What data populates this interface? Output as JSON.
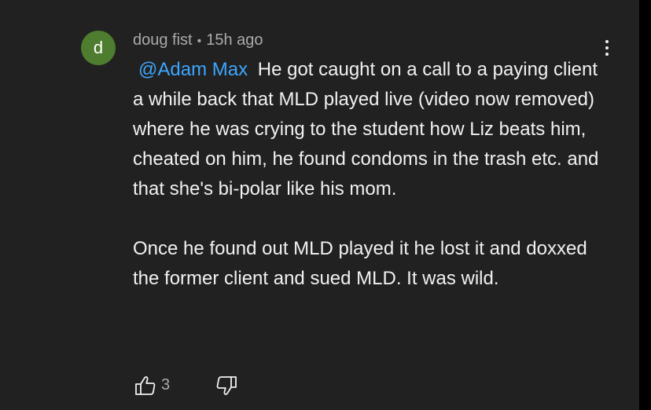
{
  "comment": {
    "avatar_letter": "d",
    "author": "doug fist",
    "separator": "•",
    "time": "15h ago",
    "mention": "@Adam Max",
    "paragraph1": "He got caught on a call to a paying client a while back that MLD played live (video now removed) where he was crying to the student how Liz beats him, cheated on him, he found condoms in the trash etc. and that she's bi-polar like his mom.",
    "paragraph2": "Once he found out MLD played it he lost it and doxxed the former client and sued MLD. It was wild.",
    "like_count": "3"
  },
  "icons": {
    "avatar_color": "#4e7d2f",
    "like": "thumbs-up-icon",
    "dislike": "thumbs-down-icon",
    "more": "more-vertical-icon"
  },
  "colors": {
    "background": "#212121",
    "text": "#f1f1f1",
    "secondary_text": "#aaaaaa",
    "mention": "#3ea6ff"
  }
}
